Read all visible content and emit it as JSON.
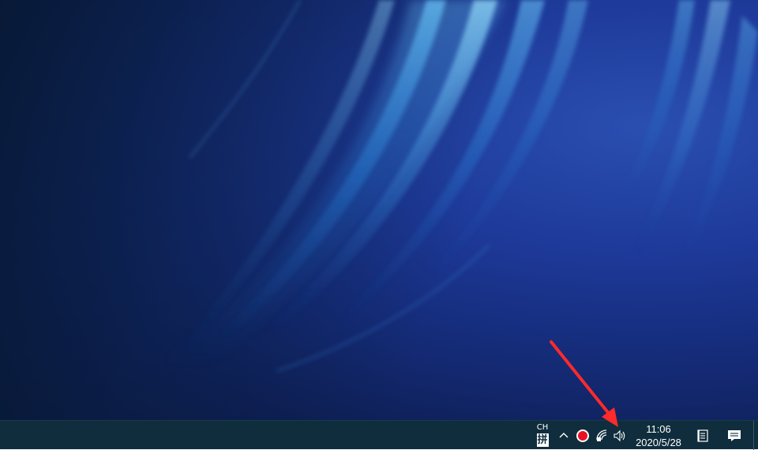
{
  "taskbar": {
    "ime": {
      "language": "CH",
      "mode": "拼"
    },
    "tray_icons": [
      "show-hidden-icons-chevron-icon",
      "record-icon",
      "network-icon",
      "volume-icon"
    ],
    "clock": {
      "time": "11:06",
      "date": "2020/5/28"
    },
    "notes_icon": "notes-icon",
    "action_center_icon": "action-center-icon"
  },
  "colors": {
    "taskbar_bg": "#0f2d3d",
    "record_red": "#e81123",
    "arrow_red": "#ff2a2a"
  }
}
